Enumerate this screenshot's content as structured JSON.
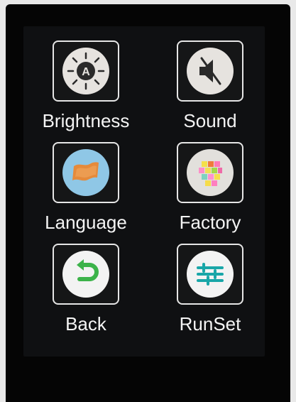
{
  "menu": {
    "items": [
      {
        "label": "Brightness",
        "icon": "brightness-icon"
      },
      {
        "label": "Sound",
        "icon": "speaker-muted-icon"
      },
      {
        "label": "Language",
        "icon": "flag-icon"
      },
      {
        "label": "Factory",
        "icon": "color-grid-icon"
      },
      {
        "label": "Back",
        "icon": "back-arrow-icon"
      },
      {
        "label": "RunSet",
        "icon": "sliders-icon"
      }
    ]
  },
  "colors": {
    "screen_bg": "#0f1012",
    "tile_border": "#e6e6e6",
    "label_text": "#f4f4f4",
    "icon_light": "#e9e6e2",
    "language_circle": "#8fc7e6",
    "language_flag": "#e58a3b",
    "back_arrow": "#3cb34a",
    "runset_lines": "#19a6a8"
  }
}
